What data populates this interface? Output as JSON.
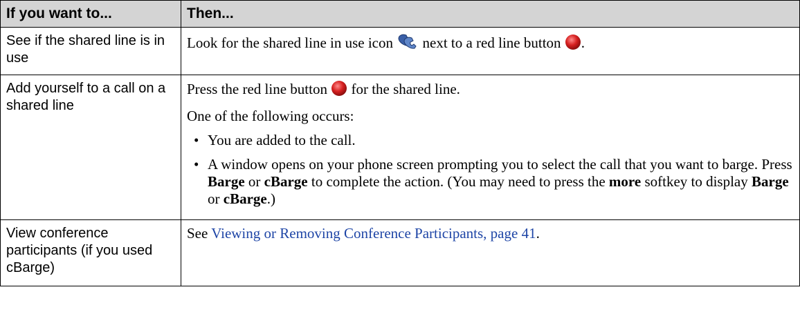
{
  "header": {
    "col1": "If you want to...",
    "col2": "Then..."
  },
  "rows": [
    {
      "task": "See if the shared line is in use",
      "text_a": "Look for the shared line in use icon",
      "text_b": "next to a red line button",
      "text_c": "."
    },
    {
      "task": "Add yourself to a call on a shared line",
      "p1_a": "Press the red line button",
      "p1_b": "for the shared line.",
      "p2": "One of the following occurs:",
      "bullet": "•",
      "b1": "You are added to the call.",
      "b2_a": "A window opens on your phone screen prompting you to select the call that you want to barge. Press",
      "b2_barge": "Barge",
      "b2_or": "or",
      "b2_cbarge": "cBarge",
      "b2_b": "to complete the action. (You may need to press the",
      "b2_more": "more",
      "b2_c": "softkey to display",
      "b2_barge2": "Barge",
      "b2_or2": "or",
      "b2_cbarge2": "cBarge",
      "b2_d": ".)"
    },
    {
      "task": "View conference participants (if you used cBarge)",
      "see": "See",
      "link": "Viewing or Removing Conference Participants, page 41",
      "end": "."
    }
  ],
  "colors": {
    "header_bg": "#d4d4d4",
    "link": "#1e45a6",
    "red_button": "#d62020",
    "icon_blue": "#3a5fa8"
  },
  "icons": [
    "shared-line-in-use-icon",
    "red-line-button-icon"
  ]
}
